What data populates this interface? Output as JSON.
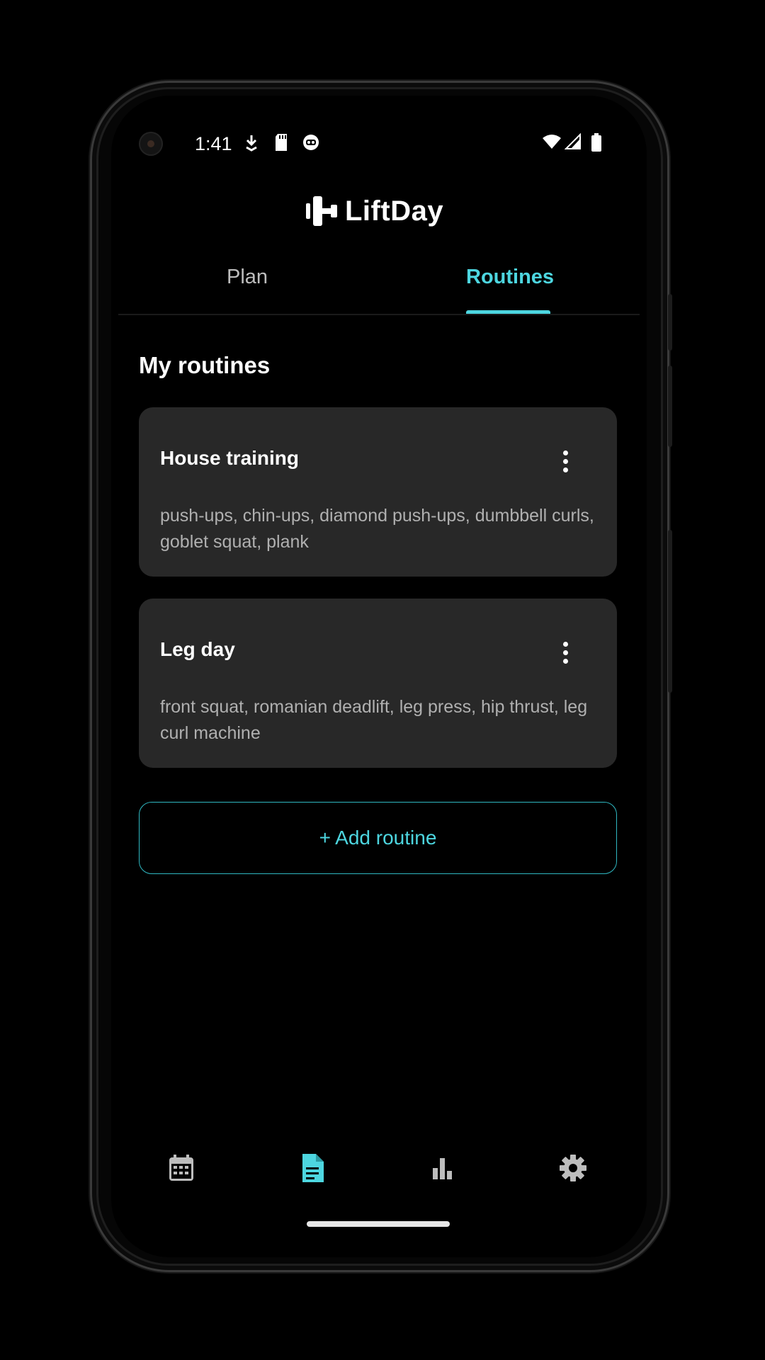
{
  "status_bar": {
    "time": "1:41",
    "icons": [
      "camera-cutout",
      "download-icon",
      "sd-card-icon",
      "android-face-icon",
      "wifi-icon",
      "signal-icon",
      "battery-icon"
    ]
  },
  "app": {
    "name": "LiftDay",
    "logo_icon": "barbell-icon"
  },
  "tabs": [
    {
      "label": "Plan",
      "active": false
    },
    {
      "label": "Routines",
      "active": true
    }
  ],
  "section_title": "My routines",
  "routines": [
    {
      "title": "House training",
      "exercises": "push-ups, chin-ups, diamond push-ups, dumbbell curls, goblet squat, plank",
      "menu_icon": "more-vert-icon"
    },
    {
      "title": "Leg day",
      "exercises": "front squat, romanian deadlift, leg press, hip thrust, leg curl machine",
      "menu_icon": "more-vert-icon"
    }
  ],
  "add_routine_label": "+ Add routine",
  "bottom_nav": [
    {
      "icon": "calendar-icon",
      "active": false
    },
    {
      "icon": "document-icon",
      "active": true
    },
    {
      "icon": "bar-chart-icon",
      "active": false
    },
    {
      "icon": "gear-icon",
      "active": false
    }
  ],
  "colors": {
    "accent": "#4dd6e0",
    "background": "#000000",
    "card": "#282828",
    "text_secondary": "#b0b0b0"
  }
}
